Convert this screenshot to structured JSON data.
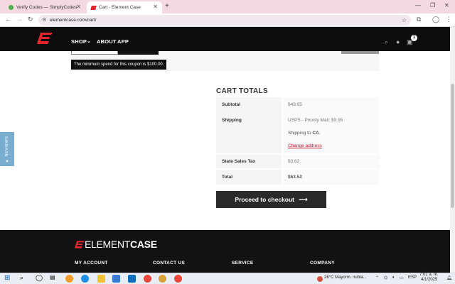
{
  "browser": {
    "tabs": [
      {
        "label": "Verify Codes — SimplyCodes",
        "active": false
      },
      {
        "label": "Cart - Element Case",
        "active": true
      }
    ],
    "url": "elementcase.com/cart/"
  },
  "header": {
    "nav": [
      "SHOP",
      "ABOUT",
      "APP"
    ],
    "cart_count": "1"
  },
  "coupon": {
    "message": "The minimum spend for this coupon is $100.00."
  },
  "reviews_tab": "★ REVIEWS",
  "cart_totals": {
    "title": "CART TOTALS",
    "subtotal_label": "Subtotal",
    "subtotal_value": "$49.95",
    "shipping_label": "Shipping",
    "shipping_method": "USPS - Priority Mail: $9.95",
    "shipping_to_prefix": "Shipping to ",
    "shipping_to_region": "CA",
    "change_address": "Change address",
    "tax_label": "State Sales Tax",
    "tax_value": "$3.62",
    "total_label": "Total",
    "total_value": "$63.52",
    "checkout_label": "Proceed to checkout"
  },
  "footer": {
    "logo_left": "ELEMENT",
    "logo_right": "CASE",
    "columns": [
      "MY ACCOUNT",
      "CONTACT US",
      "SERVICE",
      "COMPANY"
    ]
  },
  "taskbar": {
    "weather": "26°C  Mayorm. nubla...",
    "lang": "ESP",
    "time": "7:01 a. m.",
    "date": "4/1/2025"
  },
  "colors": {
    "accent_red": "#e3262d",
    "header_bg": "#0c0c0c",
    "checkout_bg": "#2a2a2a"
  }
}
